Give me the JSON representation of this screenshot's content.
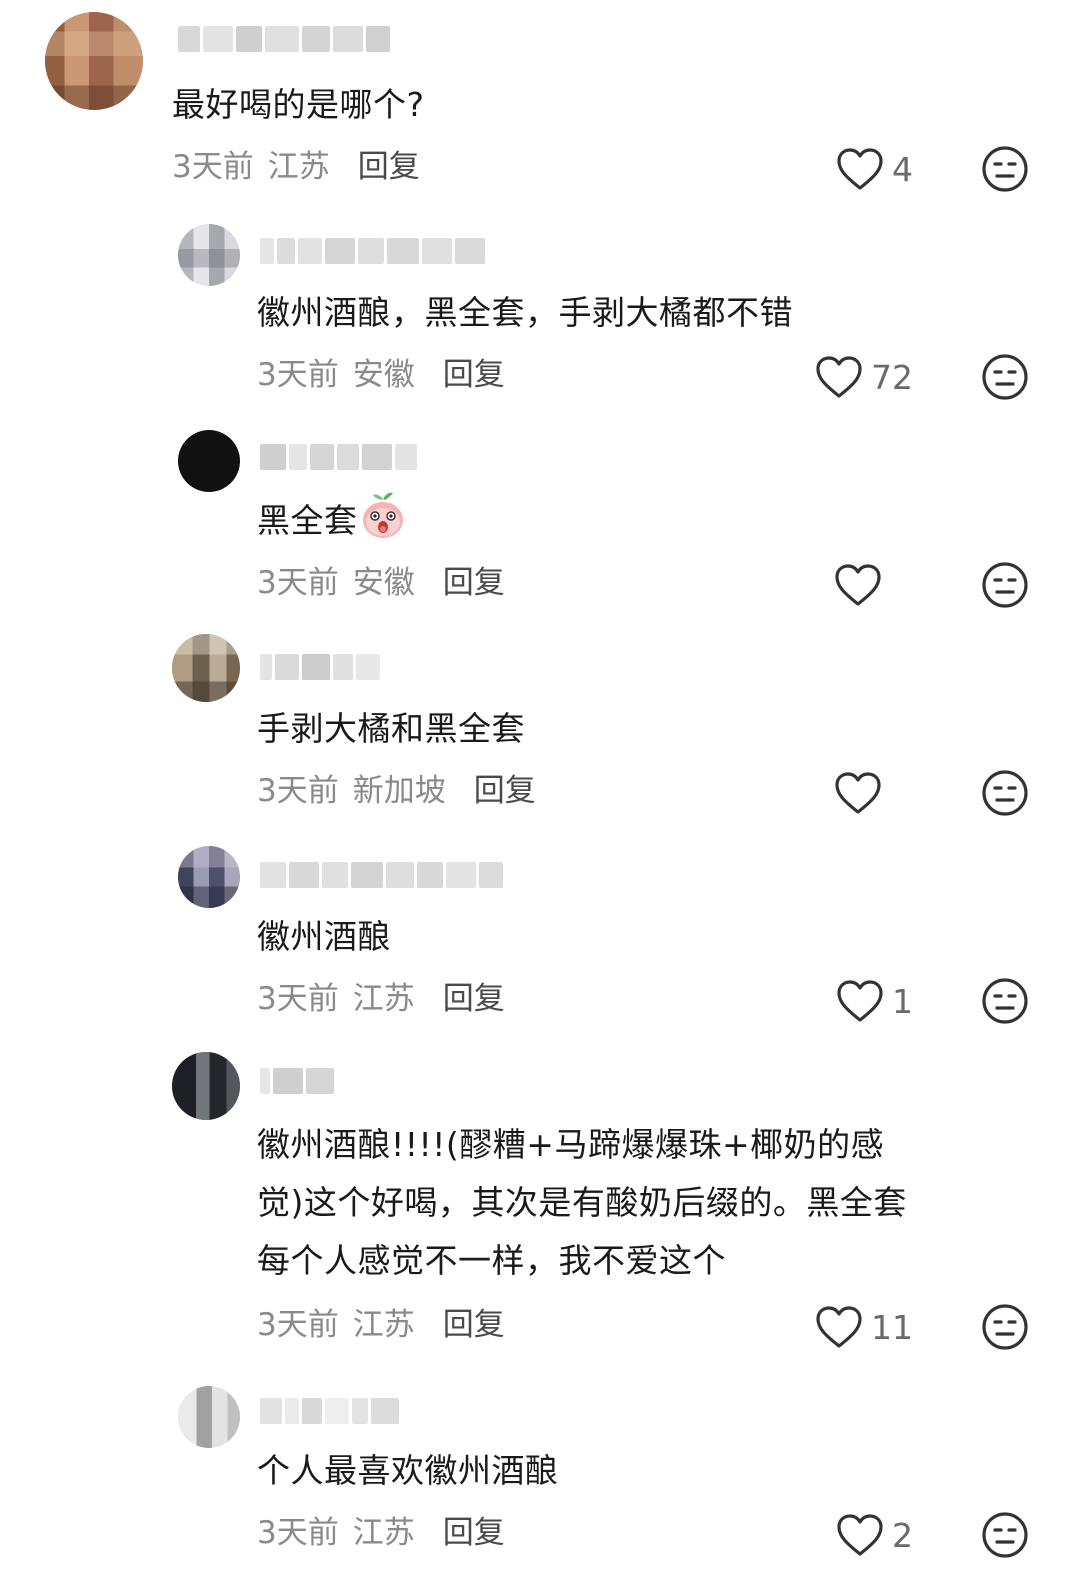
{
  "comments": [
    {
      "text": "最好喝的是哪个?",
      "time": "3天前",
      "location": "江苏",
      "reply": "回复",
      "likes": "4"
    },
    {
      "text": "徽州酒酿，黑全套，手剥大橘都不错",
      "time": "3天前",
      "location": "安徽",
      "reply": "回复",
      "likes": "72"
    },
    {
      "text": "黑全套",
      "emoji": "peach-face-emoji",
      "time": "3天前",
      "location": "安徽",
      "reply": "回复",
      "likes": ""
    },
    {
      "text": "手剥大橘和黑全套",
      "time": "3天前",
      "location": "新加坡",
      "reply": "回复",
      "likes": ""
    },
    {
      "text": "徽州酒酿",
      "time": "3天前",
      "location": "江苏",
      "reply": "回复",
      "likes": "1"
    },
    {
      "lines": [
        "徽州酒酿!!!!(醪糟+马蹄爆爆珠+椰奶的感",
        "觉)这个好喝，其次是有酸奶后缀的。黑全套",
        "每个人感觉不一样，我不爱这个"
      ],
      "time": "3天前",
      "location": "江苏",
      "reply": "回复",
      "likes": "11"
    },
    {
      "text": "个人最喜欢徽州酒酿",
      "time": "3天前",
      "location": "江苏",
      "reply": "回复",
      "likes": "2"
    }
  ],
  "colors": {
    "text": "#1a1a1a",
    "meta": "#8a8a8a",
    "icon": "#333333"
  }
}
